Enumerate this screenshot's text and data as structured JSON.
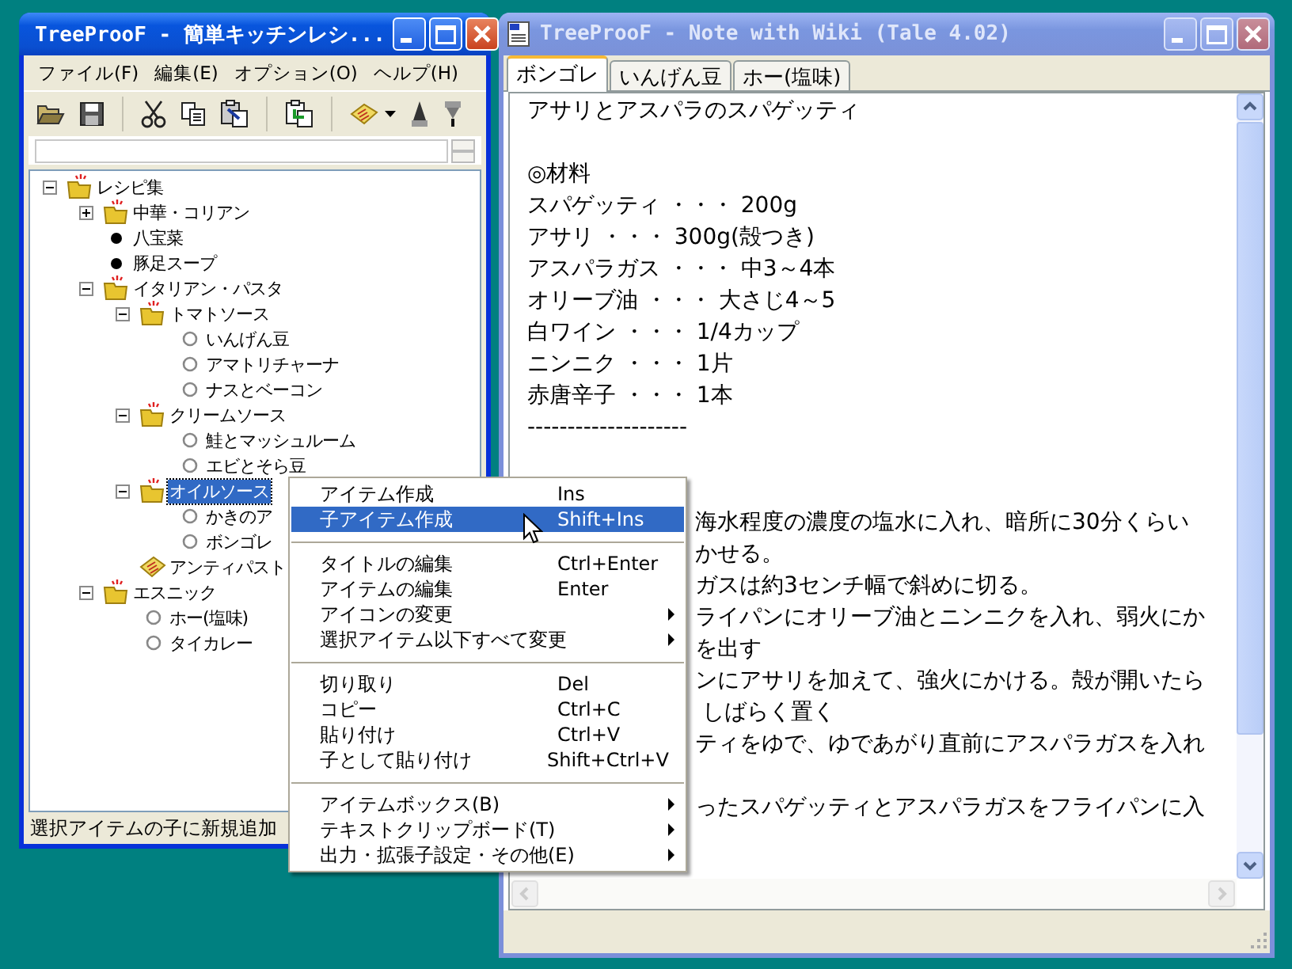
{
  "tree_window": {
    "title": "TreeProoF - 簡単キッチンレシ...",
    "active": true,
    "menu": [
      "ファイル(F)",
      "編集(E)",
      "オプション(O)",
      "ヘルプ(H)"
    ],
    "tree": [
      {
        "label": "レシピ集",
        "kind": "folder",
        "expanded": true,
        "selected": false,
        "children": [
          {
            "label": "中華・コリアン",
            "kind": "folder",
            "expanded": false,
            "selected": false
          },
          {
            "label": "八宝菜",
            "kind": "dot",
            "selected": false
          },
          {
            "label": "豚足スープ",
            "kind": "dot",
            "selected": false
          },
          {
            "label": "イタリアン・パスタ",
            "kind": "folder",
            "expanded": true,
            "selected": false,
            "children": [
              {
                "label": "トマトソース",
                "kind": "folder",
                "expanded": true,
                "selected": false,
                "children": [
                  {
                    "label": "いんげん豆",
                    "kind": "circle",
                    "selected": false
                  },
                  {
                    "label": "アマトリチャーナ",
                    "kind": "circle",
                    "selected": false
                  },
                  {
                    "label": "ナスとベーコン",
                    "kind": "circle",
                    "selected": false
                  }
                ]
              },
              {
                "label": "クリームソース",
                "kind": "folder",
                "expanded": true,
                "selected": false,
                "children": [
                  {
                    "label": "鮭とマッシュルーム",
                    "kind": "circle",
                    "selected": false
                  },
                  {
                    "label": "エビとそら豆",
                    "kind": "circle",
                    "selected": false
                  }
                ]
              },
              {
                "label": "オイルソース",
                "kind": "folder",
                "expanded": true,
                "selected": true,
                "children": [
                  {
                    "label": "かきのア",
                    "kind": "circle",
                    "selected": false
                  },
                  {
                    "label": "ボンゴレ",
                    "kind": "circle",
                    "selected": false
                  }
                ]
              },
              {
                "label": "アンティパスト",
                "kind": "note",
                "selected": false
              }
            ]
          },
          {
            "label": "エスニック",
            "kind": "folder",
            "expanded": true,
            "selected": false,
            "children": [
              {
                "label": "ホー(塩味)",
                "kind": "circle",
                "selected": false
              },
              {
                "label": "タイカレー",
                "kind": "circle",
                "selected": false
              }
            ]
          }
        ]
      }
    ],
    "status": "選択アイテムの子に新規追加"
  },
  "note_window": {
    "title": "TreeProoF - Note with Wiki (Tale 4.02)",
    "active": false,
    "tabs": [
      {
        "label": "ボンゴレ",
        "selected": true
      },
      {
        "label": "いんげん豆",
        "selected": false
      },
      {
        "label": "ホー(塩味)",
        "selected": false
      }
    ],
    "lines": [
      {
        "kind": "full",
        "text": "アサリとアスパラのスパゲッティ"
      },
      {
        "kind": "blank"
      },
      {
        "kind": "full",
        "text": "◎材料"
      },
      {
        "kind": "full",
        "text": "スパゲッティ ・・・ 200g"
      },
      {
        "kind": "full",
        "text": "アサリ ・・・ 300g(殻つき)"
      },
      {
        "kind": "full",
        "text": "アスパラガス ・・・ 中3～4本"
      },
      {
        "kind": "full",
        "text": "オリーブ油 ・・・ 大さじ4～5"
      },
      {
        "kind": "full",
        "text": "白ワイン ・・・ 1/4カップ"
      },
      {
        "kind": "full",
        "text": "ニンニク ・・・ 1片"
      },
      {
        "kind": "full",
        "text": "赤唐辛子 ・・・ 1本"
      },
      {
        "kind": "full",
        "text": "--------------------"
      },
      {
        "kind": "blank"
      },
      {
        "kind": "blank"
      },
      {
        "kind": "partial",
        "text": "海水程度の濃度の塩水に入れ、暗所に30分くらい"
      },
      {
        "kind": "partial",
        "text": "かせる。"
      },
      {
        "kind": "partial",
        "text": "ガスは約3センチ幅で斜めに切る。"
      },
      {
        "kind": "partial",
        "text": "ライパンにオリーブ油とニンニクを入れ、弱火にか"
      },
      {
        "kind": "partial",
        "text": "を出す"
      },
      {
        "kind": "partial",
        "text": "ンにアサリを加えて、強火にかける。殻が開いたら"
      },
      {
        "kind": "partial",
        "text": " しばらく置く"
      },
      {
        "kind": "partial",
        "text": "ティをゆで、ゆであがり直前にアスパラガスを入れ"
      },
      {
        "kind": "blank"
      },
      {
        "kind": "partial",
        "text": "ったスパゲッティとアスパラガスをフライパンに入"
      }
    ]
  },
  "context_menu": [
    {
      "kind": "item",
      "label": "アイテム作成",
      "shortcut": "Ins",
      "submenu": false,
      "selected": false
    },
    {
      "kind": "item",
      "label": "子アイテム作成",
      "shortcut": "Shift+Ins",
      "submenu": false,
      "selected": true
    },
    {
      "kind": "separator"
    },
    {
      "kind": "item",
      "label": "タイトルの編集",
      "shortcut": "Ctrl+Enter",
      "submenu": false,
      "selected": false
    },
    {
      "kind": "item",
      "label": "アイテムの編集",
      "shortcut": "Enter",
      "submenu": false,
      "selected": false
    },
    {
      "kind": "item",
      "label": "アイコンの変更",
      "submenu": true,
      "selected": false
    },
    {
      "kind": "item",
      "label": "選択アイテム以下すべて変更",
      "submenu": true,
      "selected": false
    },
    {
      "kind": "separator"
    },
    {
      "kind": "item",
      "label": "切り取り",
      "shortcut": "Del",
      "submenu": false,
      "selected": false
    },
    {
      "kind": "item",
      "label": "コピー",
      "shortcut": "Ctrl+C",
      "submenu": false,
      "selected": false
    },
    {
      "kind": "item",
      "label": "貼り付け",
      "shortcut": "Ctrl+V",
      "submenu": false,
      "selected": false
    },
    {
      "kind": "item",
      "label": "子として貼り付け",
      "shortcut": "Shift+Ctrl+V",
      "submenu": false,
      "selected": false
    },
    {
      "kind": "separator"
    },
    {
      "kind": "item",
      "label": "アイテムボックス(B)",
      "submenu": true,
      "selected": false
    },
    {
      "kind": "item",
      "label": "テキストクリップボード(T)",
      "submenu": true,
      "selected": false
    },
    {
      "kind": "item",
      "label": "出力・拡張子設定・その他(E)",
      "submenu": true,
      "selected": false
    }
  ]
}
